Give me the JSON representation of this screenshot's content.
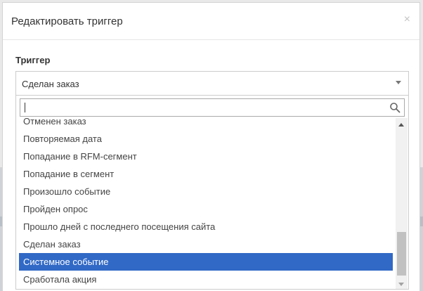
{
  "dialog": {
    "title": "Редактировать триггер",
    "close_glyph": "×"
  },
  "trigger_field": {
    "label": "Триггер",
    "selected_value": "Сделан заказ"
  },
  "dropdown": {
    "search": {
      "value": "",
      "placeholder": ""
    },
    "options": [
      "Отменен заказ",
      "Повторяемая дата",
      "Попадание в RFM-сегмент",
      "Попадание в сегмент",
      "Произошло событие",
      "Пройден опрос",
      "Прошло дней с последнего посещения сайта",
      "Сделан заказ",
      "Системное событие",
      "Сработала акция"
    ],
    "highlighted_option": "Системное событие"
  },
  "colors": {
    "highlight": "#3169c6",
    "text": "#333333"
  }
}
